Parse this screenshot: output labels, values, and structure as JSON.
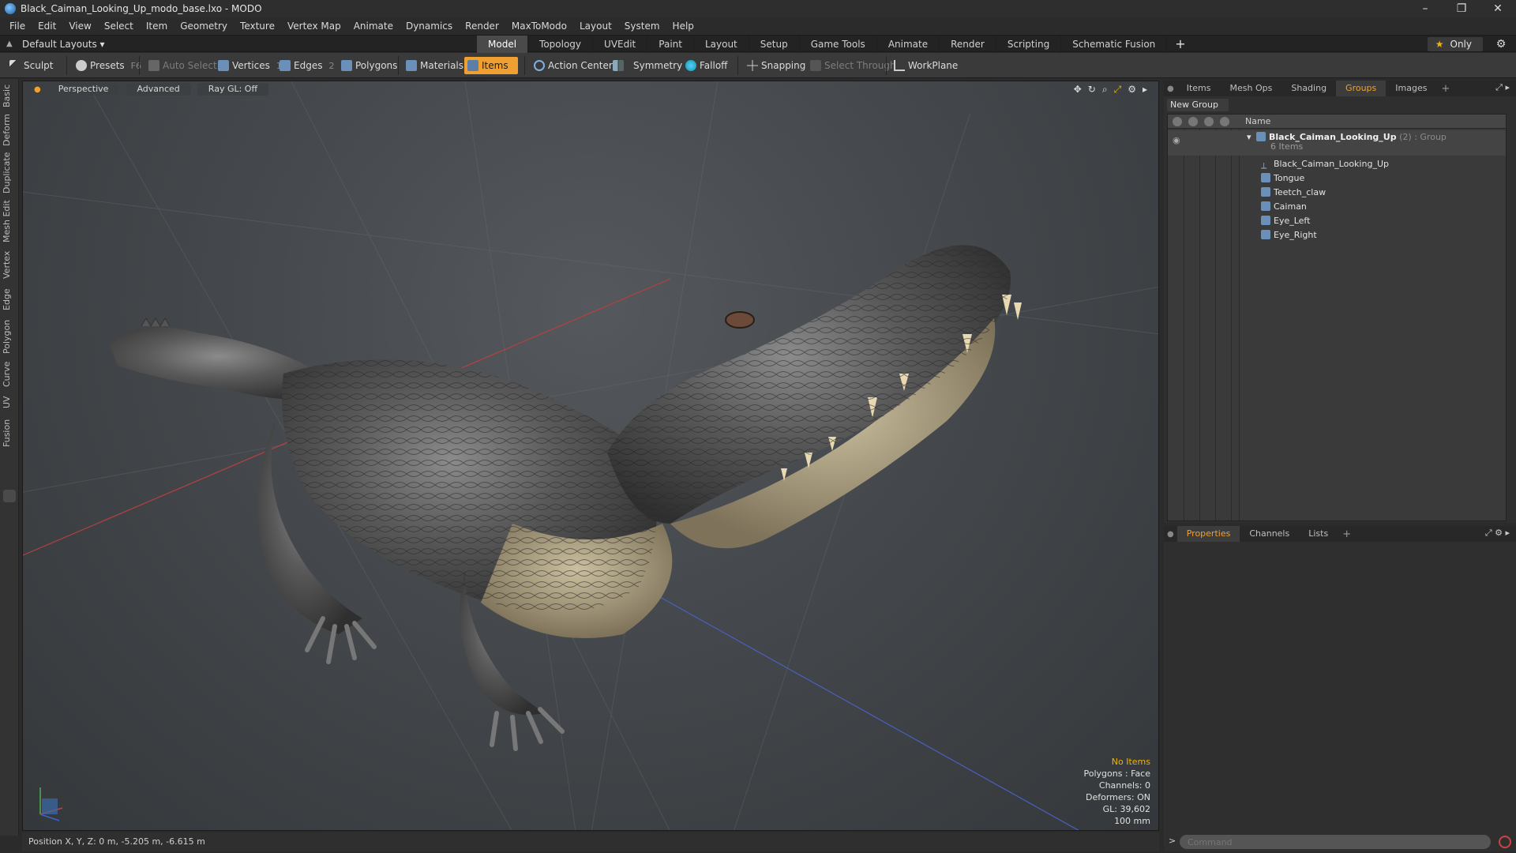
{
  "window": {
    "title": "Black_Caiman_Looking_Up_modo_base.lxo - MODO",
    "controls": [
      "–",
      "❐",
      "✕"
    ]
  },
  "menu": [
    "File",
    "Edit",
    "View",
    "Select",
    "Item",
    "Geometry",
    "Texture",
    "Vertex Map",
    "Animate",
    "Dynamics",
    "Render",
    "MaxToModo",
    "Layout",
    "System",
    "Help"
  ],
  "layout": {
    "preset": "Default Layouts ▾",
    "tabs": [
      "Model",
      "Topology",
      "UVEdit",
      "Paint",
      "Layout",
      "Setup",
      "Game Tools",
      "Animate",
      "Render",
      "Scripting",
      "Schematic Fusion"
    ],
    "active_tab": "Model",
    "only_label": "Only"
  },
  "toolbar": {
    "sculpt": "Sculpt",
    "presets": "Presets",
    "presets_key": "F6",
    "auto_select": "Auto Select",
    "vertices": "Vertices",
    "vertices_key": "1",
    "edges": "Edges",
    "edges_key": "2",
    "polygons": "Polygons",
    "materials": "Materials",
    "items": "Items",
    "action_center": "Action Center",
    "symmetry": "Symmetry",
    "falloff": "Falloff",
    "snapping": "Snapping",
    "select_through": "Select Through",
    "workplane": "WorkPlane"
  },
  "left_tabs": [
    "Basic",
    "Deform",
    "Duplicate",
    "Mesh Edit",
    "Vertex",
    "Edge",
    "Polygon",
    "Curve",
    "UV",
    "Fusion"
  ],
  "viewport": {
    "view": "Perspective",
    "shading": "Advanced",
    "raygl": "Ray GL: Off",
    "info": {
      "selection": "No Items",
      "polygons": "Polygons : Face",
      "channels": "Channels: 0",
      "deformers": "Deformers: ON",
      "gl": "GL: 39,602",
      "grid": "100 mm"
    }
  },
  "status": {
    "position": "Position X, Y, Z:  0 m, -5.205 m, -6.615 m"
  },
  "groups_panel": {
    "tabs": [
      "Items",
      "Mesh Ops",
      "Shading",
      "Groups",
      "Images"
    ],
    "active_tab": "Groups",
    "new_group": "New Group",
    "name_header": "Name",
    "group": {
      "name": "Black_Caiman_Looking_Up",
      "meta": "(2) : Group",
      "count": "6 Items"
    },
    "children": [
      "Black_Caiman_Looking_Up",
      "Tongue",
      "Teetch_claw",
      "Caiman",
      "Eye_Left",
      "Eye_Right"
    ]
  },
  "properties_panel": {
    "tabs": [
      "Properties",
      "Channels",
      "Lists"
    ],
    "active_tab": "Properties"
  },
  "command": {
    "placeholder": "Command",
    "prompt": ">"
  }
}
